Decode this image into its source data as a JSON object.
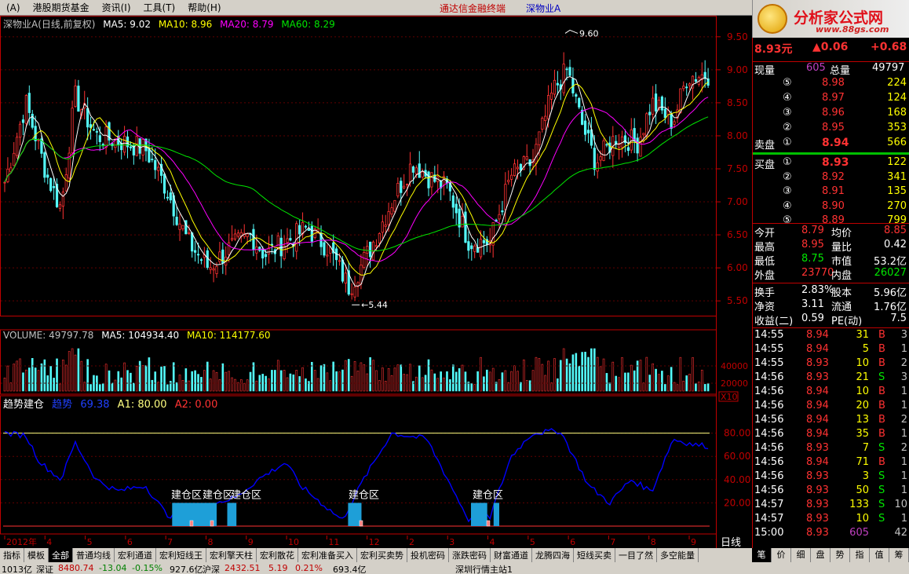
{
  "menubar": {
    "items": [
      "(A)",
      "港股期货基金",
      "资讯(I)",
      "工具(T)",
      "帮助(H)"
    ],
    "center_title": "通达信金融终端",
    "center_stock": "深物业A"
  },
  "logo": {
    "main": "分析家公式网",
    "url": "www.88gs.com"
  },
  "main_chart": {
    "legend": {
      "title": "深物业A(日线,前复权)",
      "ma5": "MA5: 9.02",
      "ma10": "MA10: 8.96",
      "ma20": "MA20: 8.79",
      "ma60": "MA60: 8.29"
    },
    "y_ticks": [
      "9.50",
      "9.00",
      "8.50",
      "8.00",
      "7.50",
      "7.00",
      "6.50",
      "6.00",
      "5.50"
    ],
    "high_label": "9.60",
    "low_label": "5.44"
  },
  "volume_chart": {
    "legend": {
      "title": "VOLUME: 49797.78",
      "ma5": "MA5: 104934.40",
      "ma10": "MA10: 114177.60"
    },
    "y_ticks": [
      "40000",
      "20000"
    ],
    "unit": "X10"
  },
  "indicator_chart": {
    "legend": {
      "title": "趋势建仓",
      "trend": "趋势",
      "trend_val": "69.38",
      "a1": "A1: 80.00",
      "a2": "A2: 0.00"
    },
    "y_ticks": [
      "80.00",
      "60.00",
      "40.00",
      "20.00"
    ],
    "zone_labels": [
      "建仓区",
      "建仓区",
      "建仓区",
      "建仓区",
      "建仓区"
    ]
  },
  "x_axis": {
    "labels": [
      "2012年",
      "4",
      "5",
      "6",
      "7",
      "8",
      "9",
      "10",
      "11",
      "12",
      "2",
      "3",
      "4",
      "5",
      "6",
      "7",
      "8",
      "9"
    ],
    "period": "日线"
  },
  "quote": {
    "price": "8.93元",
    "change": "▲0.06",
    "change_pct": "+0.68",
    "vol_now_label": "现量",
    "vol_now": "605",
    "vol_total_label": "总量",
    "vol_total": "49797",
    "sell": [
      {
        "lv": "⑤",
        "price": "8.98",
        "vol": "224"
      },
      {
        "lv": "④",
        "price": "8.97",
        "vol": "124"
      },
      {
        "lv": "③",
        "price": "8.96",
        "vol": "168"
      },
      {
        "lv": "②",
        "price": "8.95",
        "vol": "353"
      },
      {
        "lv": "①",
        "price": "8.94",
        "vol": "566"
      }
    ],
    "sell_label": "卖盘",
    "buy_label": "买盘",
    "buy": [
      {
        "lv": "①",
        "price": "8.93",
        "vol": "122"
      },
      {
        "lv": "②",
        "price": "8.92",
        "vol": "341"
      },
      {
        "lv": "③",
        "price": "8.91",
        "vol": "135"
      },
      {
        "lv": "④",
        "price": "8.90",
        "vol": "270"
      },
      {
        "lv": "⑤",
        "price": "8.89",
        "vol": "799"
      }
    ],
    "stats": [
      {
        "l1": "今开",
        "v1": "8.79",
        "l2": "均价",
        "v2": "8.85"
      },
      {
        "l1": "最高",
        "v1": "8.95",
        "l2": "量比",
        "v2": "0.42"
      },
      {
        "l1": "最低",
        "v1": "8.75",
        "l2": "市值",
        "v2": "53.2亿"
      },
      {
        "l1": "外盘",
        "v1": "23770",
        "l2": "内盘",
        "v2": "26027"
      }
    ],
    "fin": [
      {
        "l1": "换手",
        "v1": "2.83%",
        "l2": "股本",
        "v2": "5.96亿"
      },
      {
        "l1": "净资",
        "v1": "3.11",
        "l2": "流通",
        "v2": "1.76亿"
      },
      {
        "l1": "收益(二)",
        "v1": "0.59",
        "l2": "PE(动)",
        "v2": "7.5"
      }
    ],
    "ticks": [
      {
        "t": "14:55",
        "p": "8.94",
        "v": "31",
        "d": "B",
        "n": "3"
      },
      {
        "t": "14:55",
        "p": "8.94",
        "v": "5",
        "d": "B",
        "n": "1"
      },
      {
        "t": "14:55",
        "p": "8.93",
        "v": "10",
        "d": "B",
        "n": "2"
      },
      {
        "t": "14:56",
        "p": "8.93",
        "v": "21",
        "d": "S",
        "n": "3"
      },
      {
        "t": "14:56",
        "p": "8.94",
        "v": "10",
        "d": "B",
        "n": "1"
      },
      {
        "t": "14:56",
        "p": "8.94",
        "v": "20",
        "d": "B",
        "n": "1"
      },
      {
        "t": "14:56",
        "p": "8.94",
        "v": "13",
        "d": "B",
        "n": "2"
      },
      {
        "t": "14:56",
        "p": "8.94",
        "v": "35",
        "d": "B",
        "n": "1"
      },
      {
        "t": "14:56",
        "p": "8.93",
        "v": "7",
        "d": "S",
        "n": "2"
      },
      {
        "t": "14:56",
        "p": "8.94",
        "v": "71",
        "d": "B",
        "n": "1"
      },
      {
        "t": "14:56",
        "p": "8.93",
        "v": "3",
        "d": "S",
        "n": "1"
      },
      {
        "t": "14:56",
        "p": "8.93",
        "v": "50",
        "d": "S",
        "n": "1"
      },
      {
        "t": "14:57",
        "p": "8.93",
        "v": "133",
        "d": "S",
        "n": "10"
      },
      {
        "t": "14:57",
        "p": "8.93",
        "v": "10",
        "d": "S",
        "n": "1"
      },
      {
        "t": "15:00",
        "p": "8.93",
        "v": "605",
        "d": "",
        "n": "42"
      }
    ]
  },
  "tabs": [
    "指标",
    "模板",
    "全部",
    "普通均线",
    "宏利通道",
    "宏利短线王",
    "宏利擎天柱",
    "宏利散花",
    "宏利准备买入",
    "宏利买卖势",
    "投机密码",
    "涨跌密码",
    "财富通道",
    "龙腾四海",
    "短线买卖",
    "一目了然",
    "多空能量"
  ],
  "rtabs": [
    "笔",
    "价",
    "细",
    "盘",
    "势",
    "指",
    "值",
    "筹"
  ],
  "status": {
    "s1": "1013亿",
    "sz_name": "深证",
    "sz_val": "8480.74",
    "sz_chg": "-13.04",
    "sz_pct": "-0.15%",
    "sz_amt": "927.6亿",
    "hs_name": "沪深",
    "hs_val": "2432.51",
    "hs_chg": "5.19",
    "hs_pct": "0.21%",
    "hs_amt": "693.4亿",
    "server": "深圳行情主站1"
  },
  "colors": {
    "up": "#ff3232",
    "down": "#54fcfc",
    "ma5": "#ffffff",
    "ma10": "#ffff00",
    "ma20": "#ff00ff",
    "ma60": "#00e600",
    "trend": "#0000ff",
    "zone": "#1e9fd8"
  }
}
